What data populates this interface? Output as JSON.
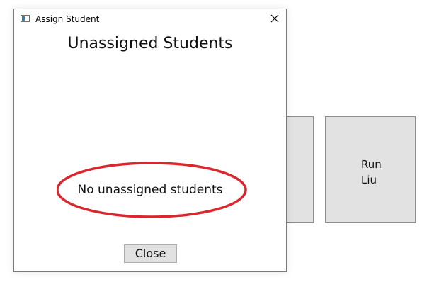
{
  "window": {
    "title": "Assign Student"
  },
  "dialog": {
    "heading": "Unassigned Students",
    "empty_message": "No unassigned students",
    "close_button_label": "Close"
  },
  "background_tiles": [
    {
      "name": ""
    },
    {
      "name": "Run\nLiu"
    }
  ],
  "icons": {
    "app": "app-window-icon",
    "close": "close-icon"
  },
  "colors": {
    "highlight_ellipse": "#d9272e",
    "tile_background": "#e2e2e2",
    "button_background": "#e1e1e1"
  }
}
